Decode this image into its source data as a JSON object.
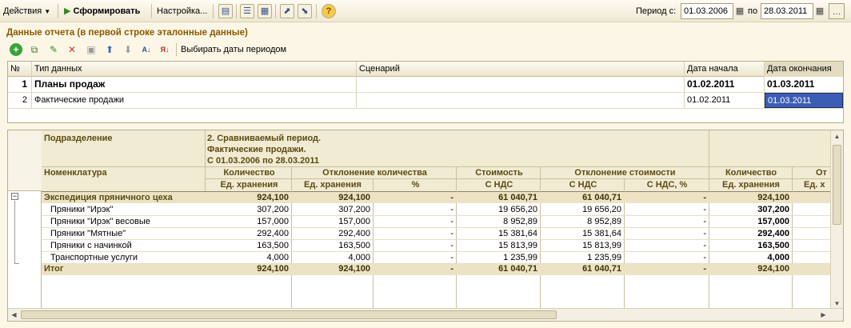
{
  "toolbar": {
    "actions_label": "Действия",
    "generate_label": "Сформировать",
    "settings_label": "Настройка...",
    "period_from_label": "Период с:",
    "period_from_value": "01.03.2006",
    "period_to_label": "по",
    "period_to_value": "28.03.2011"
  },
  "section": {
    "title": "Данные отчета (в первой строке эталонные данные)",
    "choose_dates_label": "Выбирать даты периодом"
  },
  "grid1": {
    "headers": [
      "№",
      "Тип данных",
      "Сценарий",
      "Дата начала",
      "Дата окончания"
    ],
    "rows": [
      {
        "num": "1",
        "type": "Планы продаж",
        "scenario": "",
        "start": "01.02.2011",
        "end": "01.03.2011"
      },
      {
        "num": "2",
        "type": "Фактические продажи",
        "scenario": "",
        "start": "01.02.2011",
        "end": "01.03.2011"
      }
    ]
  },
  "report": {
    "h_division": "Подразделение",
    "h_period_1": "2. Сравниваемый период.",
    "h_period_2": "Фактические продажи.",
    "h_period_3": "С 01.03.2006 по 28.03.2011",
    "h_nomenclature": "Номенклатура",
    "h_qty": "Количество",
    "h_qty_dev": "Отклонение количества",
    "h_cost": "Стоимость",
    "h_cost_dev": "Отклонение стоимости",
    "h_qty2": "Количество",
    "h_trunc": "От",
    "s_unit": "Ед. хранения",
    "s_unit2": "Ед. хранения",
    "s_pct": "%",
    "s_vat": "С НДС",
    "s_vat2": "С НДС",
    "s_vat_pct": "С НДС, %",
    "s_unit3": "Ед. хранения",
    "s_trunc": "Ед. х",
    "rows": [
      {
        "name": "Экспедиция пряничного цеха",
        "q": "924,100",
        "qd": "924,100",
        "p": "-",
        "c": "61 040,71",
        "cd": "61 040,71",
        "cp": "-",
        "q2": "924,100"
      },
      {
        "name": "Пряники \"Ирэк\"",
        "q": "307,200",
        "qd": "307,200",
        "p": "-",
        "c": "19 656,20",
        "cd": "19 656,20",
        "cp": "-",
        "q2": "307,200"
      },
      {
        "name": "Пряники \"Ирэк\" весовые",
        "q": "157,000",
        "qd": "157,000",
        "p": "-",
        "c": "8 952,89",
        "cd": "8 952,89",
        "cp": "-",
        "q2": "157,000"
      },
      {
        "name": "Пряники \"Мятные\"",
        "q": "292,400",
        "qd": "292,400",
        "p": "-",
        "c": "15 381,64",
        "cd": "15 381,64",
        "cp": "-",
        "q2": "292,400"
      },
      {
        "name": "Пряники с начинкой",
        "q": "163,500",
        "qd": "163,500",
        "p": "-",
        "c": "15 813,99",
        "cd": "15 813,99",
        "cp": "-",
        "q2": "163,500"
      },
      {
        "name": "Транспортные услуги",
        "q": "4,000",
        "qd": "4,000",
        "p": "-",
        "c": "1 235,99",
        "cd": "1 235,99",
        "cp": "-",
        "q2": "4,000"
      },
      {
        "name": "Итог",
        "q": "924,100",
        "qd": "924,100",
        "p": "-",
        "c": "61 040,71",
        "cd": "61 040,71",
        "cp": "-",
        "q2": "924,100"
      }
    ]
  },
  "colors": {
    "group_row": "#ece3c4",
    "header_bg": "#f2ebd3",
    "selection": "#3b5eb4"
  }
}
